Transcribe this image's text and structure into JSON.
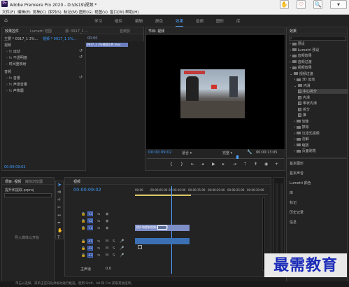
{
  "window": {
    "logo_text": "Pr",
    "title": "Adobe Premiere Pro 2020 - D:\\ds19\\视频 *"
  },
  "menu": [
    "文件(F)",
    "编辑(E)",
    "剪辑(C)",
    "序列(S)",
    "标记(M)",
    "图形(G)",
    "视图(V)",
    "窗口(W)",
    "帮助(H)"
  ],
  "toolbar_icons": [
    "hand-icon",
    "zoom-icon"
  ],
  "workspaces": [
    {
      "label": "学习",
      "active": false
    },
    {
      "label": "组件",
      "active": false
    },
    {
      "label": "编辑",
      "active": false
    },
    {
      "label": "颜色",
      "active": false
    },
    {
      "label": "效果",
      "active": true
    },
    {
      "label": "音频",
      "active": false
    },
    {
      "label": "图形",
      "active": false
    },
    {
      "label": "库",
      "active": false
    }
  ],
  "effect_controls": {
    "tabs": [
      "效果控件",
      "Lumetri 范围",
      "源: 0917_1 ...",
      "音频剪"
    ],
    "source_path": "主要 * 0917_1 3%...",
    "sequence_path": "视频 * 0917_1 3%...",
    "timecode_header": "00:00",
    "clip_label": "0917_1 3%视频文件.mov",
    "video_header": "视频",
    "video_rows": [
      "运动",
      "不透明度",
      "时间重映射"
    ],
    "audio_header": "音频",
    "audio_rows": [
      "音量",
      "声道音量",
      "声像器"
    ],
    "timecode": "00:00:09:02"
  },
  "program_monitor": {
    "tab": "节目: 视频",
    "timecode_left": "00:00:09:02",
    "fit": "适合",
    "quality": "完整",
    "timecode_right": "00:00:13:05"
  },
  "effects_panel": {
    "title": "效果",
    "search_placeholder": "",
    "tree": [
      {
        "label": "预设",
        "type": "folder",
        "level": 0
      },
      {
        "label": "Lumetri 预设",
        "type": "folder",
        "level": 0
      },
      {
        "label": "音频效果",
        "type": "folder",
        "level": 0
      },
      {
        "label": "音频过渡",
        "type": "folder",
        "level": 0
      },
      {
        "label": "视频效果",
        "type": "folder",
        "level": 0
      },
      {
        "label": "视频过渡",
        "type": "folder",
        "level": 0,
        "open": true
      },
      {
        "label": "3D 运动",
        "type": "folder",
        "level": 1
      },
      {
        "label": "内滑",
        "type": "folder",
        "level": 1,
        "open": true
      },
      {
        "label": "中心拆分",
        "type": "effect",
        "level": 2,
        "selected": true
      },
      {
        "label": "内滑",
        "type": "effect",
        "level": 2
      },
      {
        "label": "带状内滑",
        "type": "effect",
        "level": 2
      },
      {
        "label": "拆分",
        "type": "effect",
        "level": 2
      },
      {
        "label": "推",
        "type": "effect",
        "level": 2
      },
      {
        "label": "划像",
        "type": "folder",
        "level": 1
      },
      {
        "label": "擦除",
        "type": "folder",
        "level": 1
      },
      {
        "label": "沉浸式视频",
        "type": "folder",
        "level": 1
      },
      {
        "label": "溶解",
        "type": "folder",
        "level": 1
      },
      {
        "label": "缩放",
        "type": "folder",
        "level": 1
      },
      {
        "label": "页面剥落",
        "type": "folder",
        "level": 1
      }
    ],
    "side_panels": [
      "基本图形",
      "基本声音",
      "Lumetri 颜色",
      "库",
      "标记",
      "历史记录",
      "信息"
    ]
  },
  "project_panel": {
    "tabs": [
      "项目: 视频",
      "媒体浏览器"
    ],
    "file": "提升和提取.prproj",
    "import_hint": "导入媒体以开始"
  },
  "timeline": {
    "tab": "视频",
    "timecode": "00:00:09:02",
    "ruler": [
      "00:00",
      "00:00:05:00",
      "00:00:10:00",
      "00:00:15:00",
      "00:00:20:00",
      "00:00:25:00",
      "00:00:30:00"
    ],
    "video_tracks": [
      "V3",
      "V2",
      "V1"
    ],
    "audio_tracks": [
      "A1",
      "A2",
      "A3"
    ],
    "master_label": "主声道",
    "master_value": "0.0",
    "clip_v1": "提升和提取视频.mov [V]",
    "clip_a1": ""
  },
  "status": {
    "text": "单击以选择，或单击空白处并拖动进行框选。使用 Shift、Alt 和 Ctrl 获取其他选项。"
  },
  "watermark": "最需教育",
  "colors": {
    "accent": "#3e9cff",
    "video_clip": "#7e8fc8",
    "audio_clip": "#3b70b5",
    "playhead": "#4ea1ff"
  }
}
